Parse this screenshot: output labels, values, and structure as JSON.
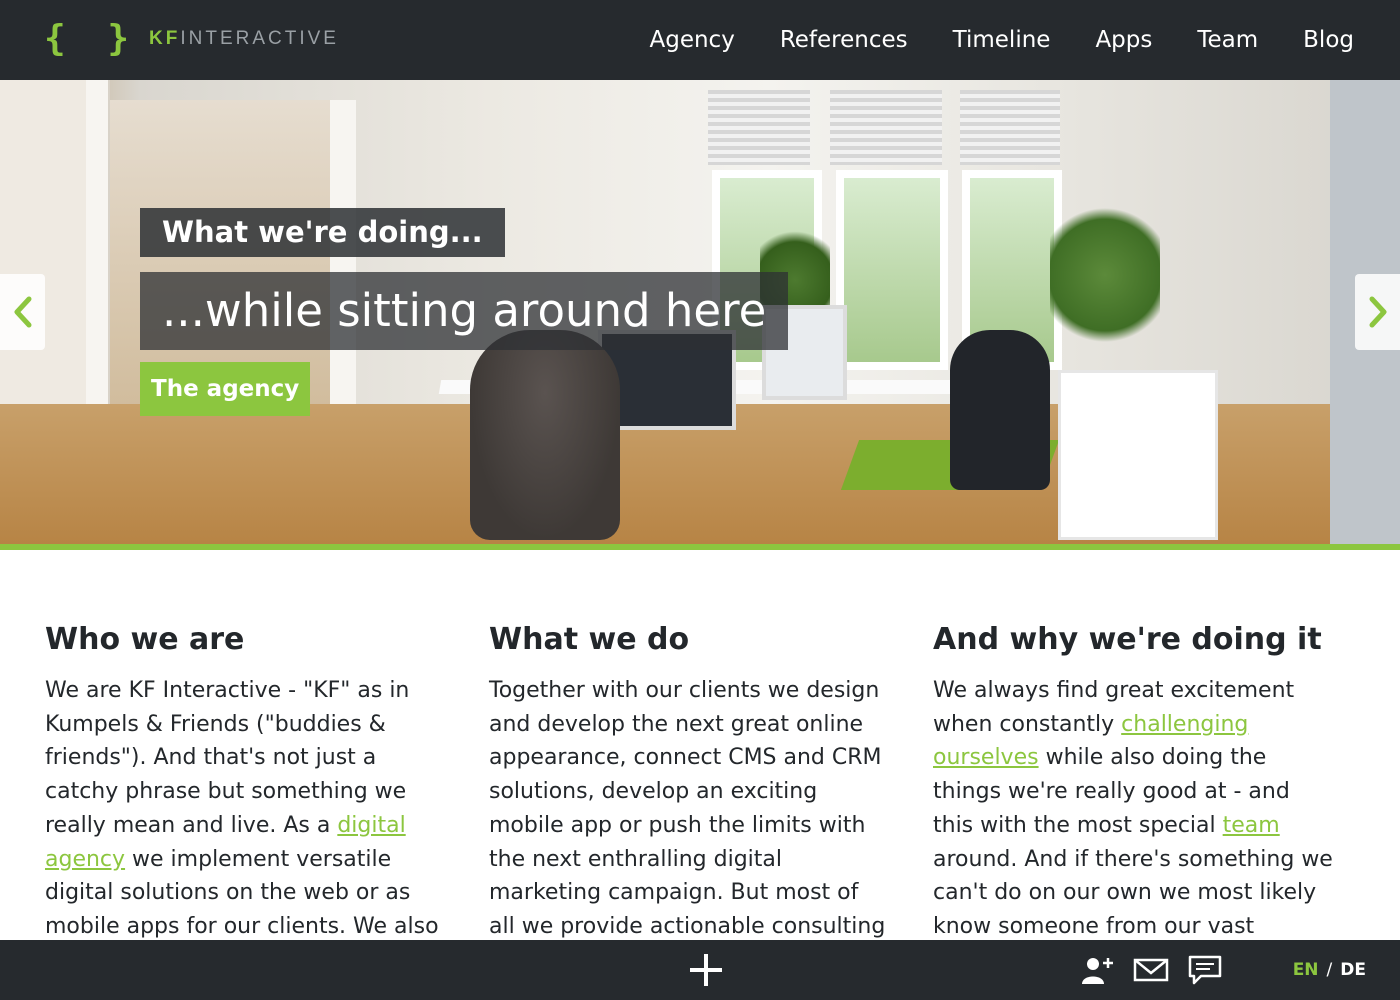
{
  "header": {
    "logo_mark": "{ }",
    "logo_kf": "KF",
    "logo_rest": "INTERACTIVE",
    "nav": [
      "Agency",
      "References",
      "Timeline",
      "Apps",
      "Team",
      "Blog"
    ]
  },
  "hero": {
    "caption_small": "What we're doing...",
    "caption_large": "...while sitting around here",
    "button_label": "The agency",
    "prev_icon": "chevron-left-icon",
    "next_icon": "chevron-right-icon"
  },
  "columns": [
    {
      "title": "Who we are",
      "text_before": "We are KF Interactive - \"KF\" as in Kumpels & Friends (\"buddies & friends\"). And that's not just a catchy phrase but something we really mean and live. As a ",
      "link": "digital agency",
      "text_after": " we implement versatile digital solutions on the web or as mobile apps for our clients. We also"
    },
    {
      "title": "What we do",
      "text": "Together with our clients we design and develop the next great online appearance, connect CMS and CRM solutions, develop an exciting mobile app or push the limits with the next enthralling digital marketing campaign. But most of all we provide actionable consulting"
    },
    {
      "title": "And why we're doing it",
      "text_before": "We always find great excitement when constantly ",
      "link1": "challenging ourselves",
      "text_middle": " while also doing the things we're really good at - and this with the most special ",
      "link2": "team",
      "text_after": " around. And if there's something we can't do on our own we most likely know someone from our vast network of"
    }
  ],
  "footer": {
    "icons": [
      "plus-icon",
      "add-contact-icon",
      "mail-icon",
      "chat-icon"
    ],
    "lang_en": "EN",
    "lang_sep": "/",
    "lang_de": "DE"
  },
  "colors": {
    "accent": "#8cc63f",
    "dark": "#262a2e",
    "text": "#23272b"
  }
}
